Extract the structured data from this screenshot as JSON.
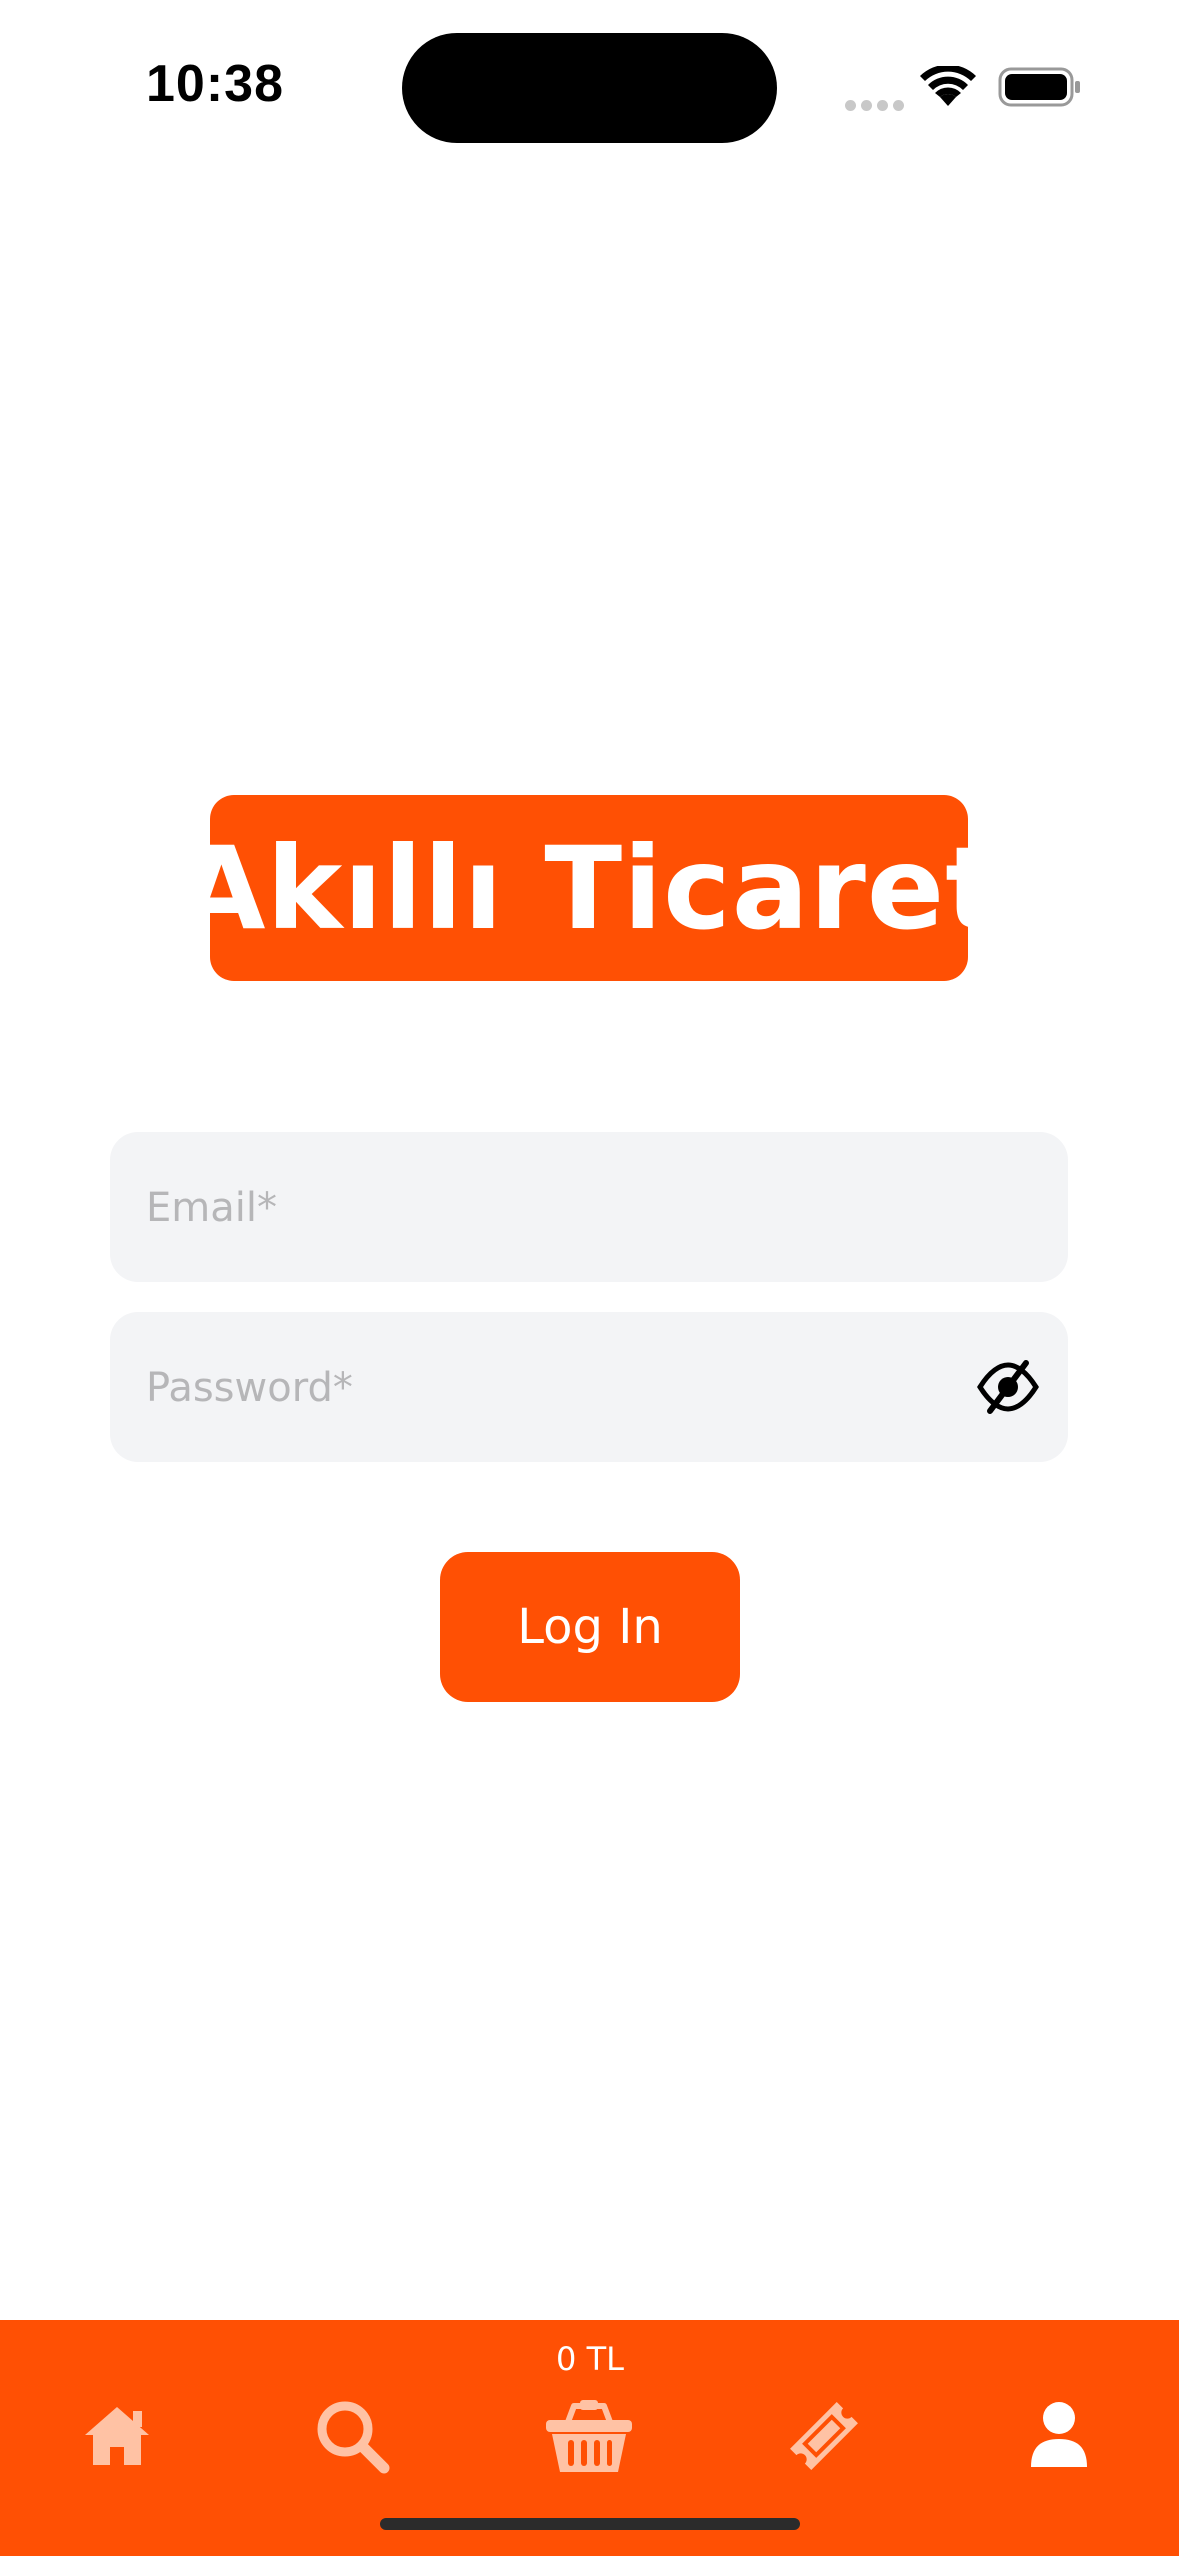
{
  "status_bar": {
    "time": "10:38"
  },
  "logo": {
    "text": "Akıllı Ticaret",
    "color": "#ff5004"
  },
  "login_form": {
    "email_placeholder": "Email*",
    "password_placeholder": "Password*",
    "password_toggle_icon": "eye-slash-icon",
    "login_label": "Log In"
  },
  "tab_bar": {
    "cart_total": "0 TL",
    "items": [
      {
        "icon": "home-icon",
        "active": false
      },
      {
        "icon": "search-icon",
        "active": false
      },
      {
        "icon": "basket-icon",
        "active": false
      },
      {
        "icon": "ticket-icon",
        "active": false
      },
      {
        "icon": "user-icon",
        "active": true
      }
    ],
    "background": "#ff5004",
    "inactive_icon_color": "#ffc2a4",
    "active_icon_color": "#ffffff"
  }
}
